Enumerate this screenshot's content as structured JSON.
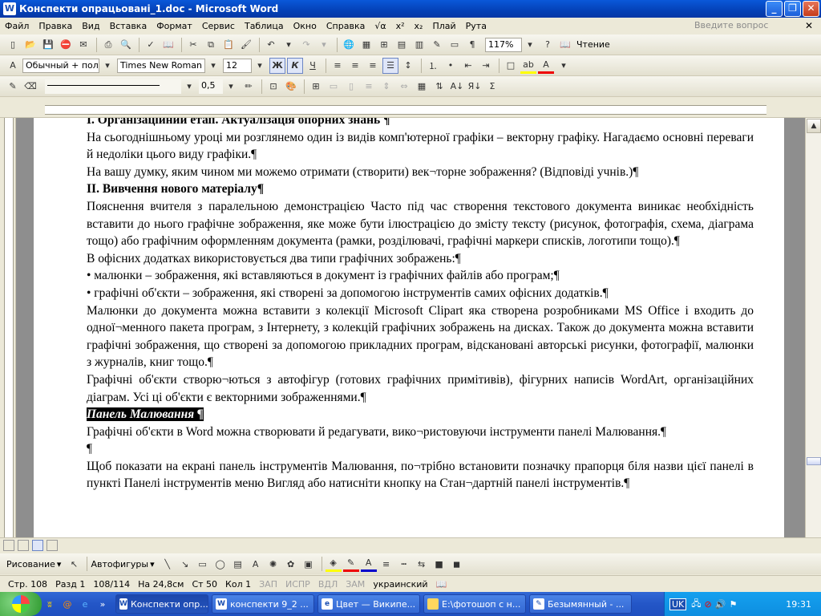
{
  "window": {
    "title": "Конспекти опрацьовані_1.doc - Microsoft Word"
  },
  "menu": {
    "items": [
      "Файл",
      "Правка",
      "Вид",
      "Вставка",
      "Формат",
      "Сервис",
      "Таблица",
      "Окно",
      "Справка",
      "√α",
      "x²",
      "x₂",
      "Плай",
      "Рута"
    ],
    "ask_placeholder": "Введите вопрос"
  },
  "toolbar_standard": {
    "zoom": "117%",
    "reading_label": "Чтение"
  },
  "toolbar_format": {
    "style": "Обычный + пол",
    "font": "Times New Roman",
    "size": "12",
    "bold": "Ж",
    "italic": "К",
    "underline": "Ч"
  },
  "toolbar_tables": {
    "line_weight": "0,5"
  },
  "document": {
    "paragraphs": [
      {
        "text": "I. Організаційний етап. Актуалізація опорних знань ¶",
        "bold": true
      },
      {
        "text": "На сьогоднішньому уроці ми розглянемо один із видів комп'ютерної графіки – векторну графіку. Нагадаємо основні переваги й недоліки цього виду графіки.¶"
      },
      {
        "text": "На вашу думку, яким чином ми можемо отримати (створити) век¬торне зображення? (Відповіді учнів.)¶"
      },
      {
        "text": "II. Вивчення нового матеріалу¶",
        "bold": true
      },
      {
        "text": "Пояснення вчителя з паралельною демонстрацією Часто під час створення текстового документа виникає необхідність вставити до нього графічне зображення, яке може бути ілюстрацією до змісту тексту (рисунок, фотографія, схема, діаграма тощо) або графічним оформленням документа (рамки, розділювачі, графічні маркери списків, логотипи тощо).¶"
      },
      {
        "text": "В офісних додатках використовується два типи графічних зображень:¶"
      },
      {
        "text": "• малюнки – зображення, які вставляються в документ із графічних файлів або програм;¶"
      },
      {
        "text": "• графічні об'єкти – зображення, які створені за допомогою інструментів самих офісних додатків.¶"
      },
      {
        "text": "Малюнки до документа можна вставити з колекції Microsoft Clipart яка створена розробниками MS Office і входить до одної¬менного пакета програм, з Інтернету, з колекцій графічних зображень на дисках. Також до документа можна вставити графічні зображення, що створені за допомогою прикладних програм, відскановані авторські рисунки, фотографії, малюнки з журналів, книг тощо.¶"
      },
      {
        "text": "Графічні об'єкти створю¬ються з автофігур (готових графічних примітивів), фігурних написів WordArt, організаційних діаграм. Усі ці об'єкти є векторними зображеннями.¶"
      },
      {
        "text": "Панель Малювання ¶",
        "highlight": true
      },
      {
        "text": "Графічні об'єкти в Word можна створювати й редагувати, вико¬ристовуючи інструменти панелі Малювання.¶"
      },
      {
        "text": "¶"
      },
      {
        "text": "Щоб показати на екрані панель інструментів Малювання, по¬трібно встановити позначку прапорця біля назви цієї панелі в пункті Панелі інструментів меню Вигляд або натисніти кнопку на Стан¬дартній панелі інструментів.¶"
      }
    ]
  },
  "drawing_toolbar": {
    "draw_label": "Рисование",
    "autoshapes_label": "Автофигуры"
  },
  "status": {
    "page": "Стр. 108",
    "section": "Разд 1",
    "pages": "108/114",
    "at": "На 24,8см",
    "line": "Ст 50",
    "col": "Кол 1",
    "rec": "ЗАП",
    "trk": "ИСПР",
    "ext": "ВДЛ",
    "ovr": "ЗАМ",
    "lang": "украинский"
  },
  "taskbar": {
    "tasks": [
      "Конспекти опр...",
      "конспекти 9_2 ...",
      "Цвет — Википе...",
      "E:\\фотошоп с н...",
      "Безымянный - ..."
    ],
    "lang": "UK",
    "clock": "19:31"
  }
}
